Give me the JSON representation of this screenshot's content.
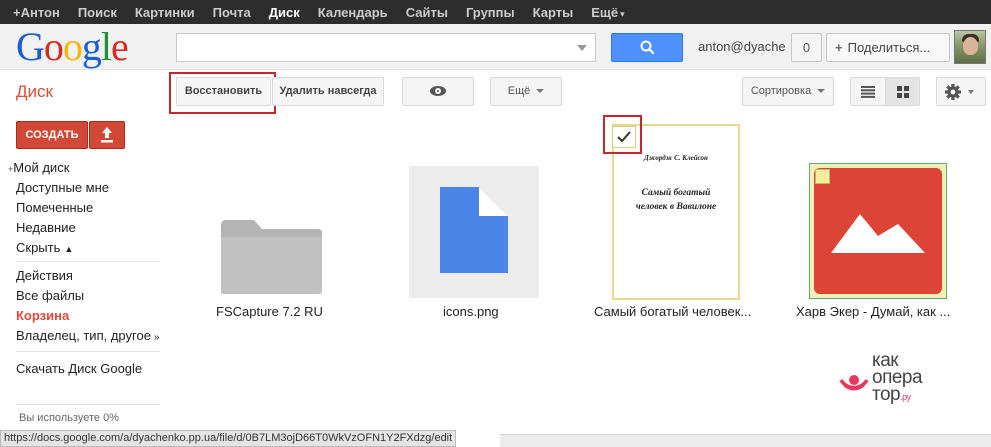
{
  "topbar": {
    "links": [
      "+Антон",
      "Поиск",
      "Картинки",
      "Почта",
      "Диск",
      "Календарь",
      "Сайты",
      "Группы",
      "Карты",
      "Ещё"
    ],
    "active": "Диск"
  },
  "header": {
    "logo_letters": [
      "G",
      "o",
      "o",
      "g",
      "l",
      "e"
    ],
    "logo_colors": [
      "#1a5ed8",
      "#d62d20",
      "#f6b70b",
      "#1a5ed8",
      "#169436",
      "#d62d20"
    ],
    "search_placeholder": "",
    "user_email": "anton@dyachenko.pp.ua",
    "notification_count": "0",
    "share_label": "Поделиться...",
    "search_icon": "magnifier-icon"
  },
  "toolbar": {
    "section_title": "Диск",
    "restore": "Восстановить",
    "delete_forever": "Удалить навсегда",
    "preview_icon": "eye-icon",
    "more": "Ещё",
    "sort": "Сортировка",
    "list_view_icon": "list-view-icon",
    "grid_view_icon": "grid-view-icon",
    "settings_icon": "gear-icon"
  },
  "sidebar": {
    "create": "СОЗДАТЬ",
    "upload_icon": "upload-icon",
    "group1": [
      "Мой диск",
      "Доступные мне",
      "Помеченные",
      "Недавние",
      "Скрыть"
    ],
    "group2": [
      "Действия",
      "Все файлы",
      "Корзина",
      "Владелец, тип, другое"
    ],
    "active_item": "Корзина",
    "download": "Скачать Диск Google",
    "usage": "Вы используете 0%"
  },
  "files": [
    {
      "name": "FSCapture 7.2 RU",
      "type": "folder"
    },
    {
      "name": "icons.png",
      "type": "image"
    },
    {
      "name": "Самый богатый человек...",
      "type": "document",
      "checked": true,
      "doc_author": "Джордж С. Клейсон",
      "doc_title": "Самый богатый человек в Вавилоне"
    },
    {
      "name": "Харв Экер - Думай, как ...",
      "type": "picture",
      "checked": false
    }
  ],
  "status_url": "https://docs.google.com/a/dyachenko.pp.ua/file/d/0B7LM3ojD66T0WkVzOFN1Y2FXdzg/edit",
  "watermark": {
    "line1": "как",
    "line2": "опера",
    "line3": "тор",
    "suffix": ".ру"
  }
}
